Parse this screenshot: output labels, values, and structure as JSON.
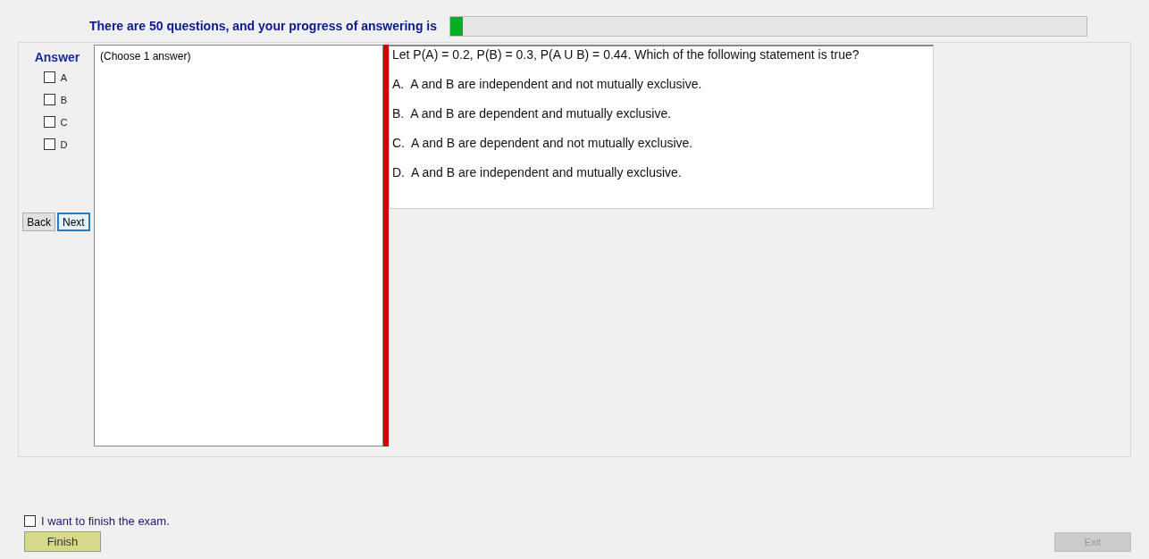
{
  "header": {
    "text": "There are 50 questions, and your progress of answering is",
    "level": 0.02
  },
  "answer_panel": {
    "title": "Answer",
    "options": [
      {
        "label": "A",
        "checked": false
      },
      {
        "label": "B",
        "checked": false
      },
      {
        "label": "C",
        "checked": false
      },
      {
        "label": "D",
        "checked": false
      }
    ]
  },
  "nav_buttons": [
    {
      "label": "Back",
      "focused": false
    },
    {
      "label": "Next",
      "focused": true
    }
  ],
  "choice_box": {
    "text": "(Choose 1 answer)"
  },
  "question": {
    "text": "Let P(A) = 0.2, P(B) = 0.3, P(A U B) = 0.44. Which of the following statement is true?",
    "options": [
      {
        "letter": "A.",
        "text": "A and B are independent and not mutually exclusive."
      },
      {
        "letter": "B.",
        "text": "A and B are dependent and mutually exclusive."
      },
      {
        "letter": "C.",
        "text": "A and B are dependent and not mutually exclusive."
      },
      {
        "letter": "D.",
        "text": "A and B are independent and mutually exclusive."
      }
    ]
  },
  "finish": {
    "label": "I want to finish the exam.",
    "checked": false
  },
  "finish_button": {
    "label": "Finish",
    "disabled": false
  },
  "exit_button": {
    "label": "Exit",
    "disabled": true
  }
}
